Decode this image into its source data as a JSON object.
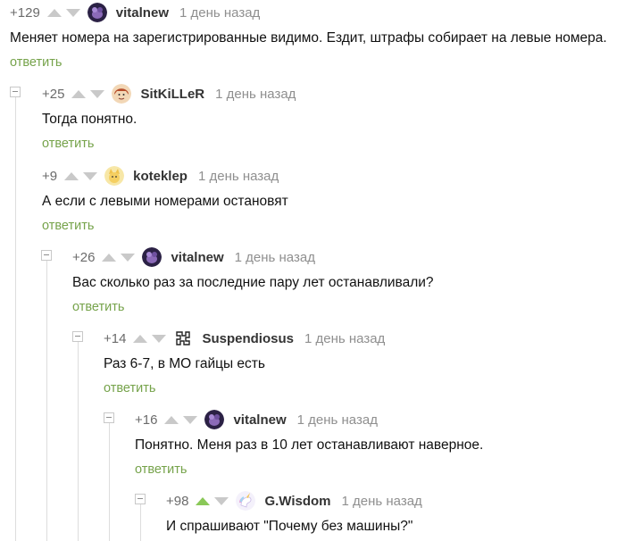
{
  "comments": [
    {
      "rating": "+129",
      "author": "vitalnew",
      "time": "1 день назад",
      "text": "Меняет номера на зарегистрированные видимо. Ездит, штрафы собирает на левые номера.",
      "reply": "ответить",
      "avatar_icon": "purple-dog-avatar",
      "upvoted": false
    },
    {
      "rating": "+25",
      "author": "SitKiLLeR",
      "time": "1 день назад",
      "text": "Тогда понятно.",
      "reply": "ответить",
      "avatar_icon": "red-hair-avatar",
      "upvoted": false
    },
    {
      "rating": "+9",
      "author": "koteklep",
      "time": "1 день назад",
      "text": "А если с левыми номерами остановят",
      "reply": "ответить",
      "avatar_icon": "yellow-cat-avatar",
      "upvoted": false
    },
    {
      "rating": "+26",
      "author": "vitalnew",
      "time": "1 день назад",
      "text": "Вас сколько раз за последние пару лет останавливали?",
      "reply": "ответить",
      "avatar_icon": "purple-dog-avatar",
      "upvoted": false
    },
    {
      "rating": "+14",
      "author": "Suspendiosus",
      "time": "1 день назад",
      "text": "Раз 6-7, в МО гайцы есть",
      "reply": "ответить",
      "avatar_icon": "puzzle-logo-avatar",
      "upvoted": false
    },
    {
      "rating": "+16",
      "author": "vitalnew",
      "time": "1 день назад",
      "text": "Понятно. Меня раз в 10 лет останавливают наверное.",
      "reply": "ответить",
      "avatar_icon": "purple-dog-avatar",
      "upvoted": false
    },
    {
      "rating": "+98",
      "author": "G.Wisdom",
      "time": "1 день назад",
      "text": "И спрашивают \"Почему без машины?\"",
      "reply": "",
      "avatar_icon": "unicorn-avatar",
      "upvoted": true
    }
  ],
  "colors": {
    "vote_inactive": "#c9c9c9",
    "vote_active": "#8ac858",
    "reply_link": "#76a34b",
    "meta_text": "#8f8f8f",
    "body_text": "#111111"
  }
}
